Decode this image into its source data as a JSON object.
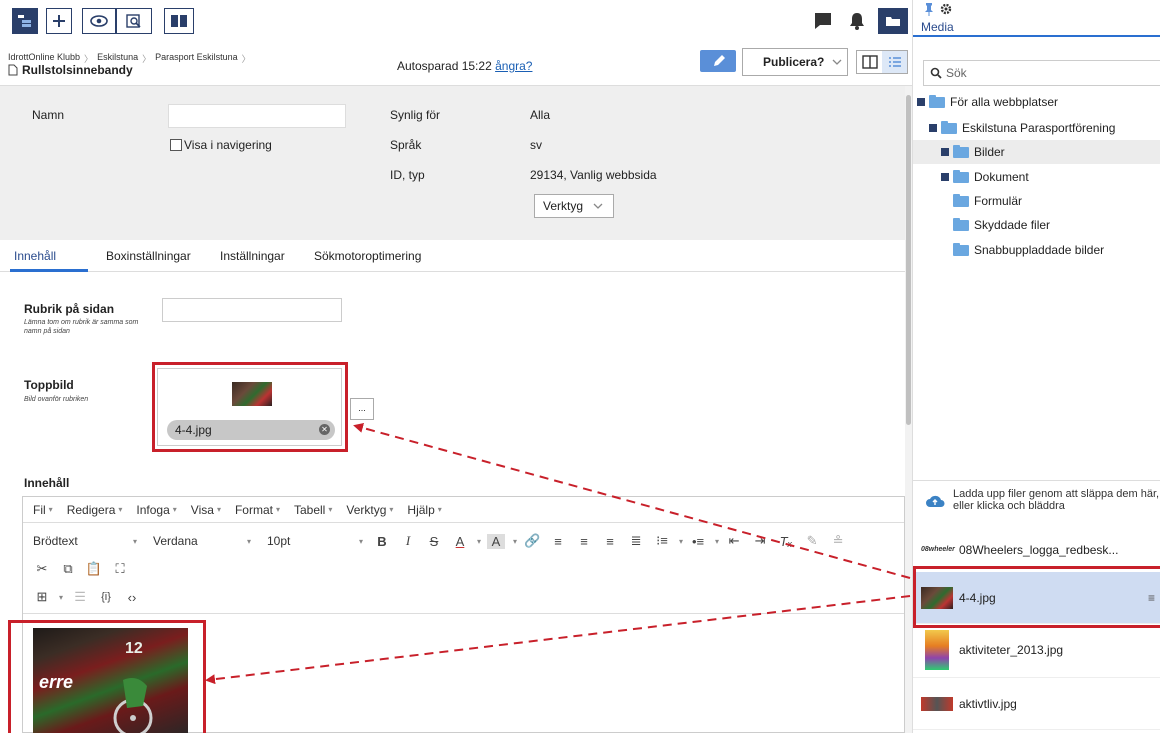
{
  "page_title": "Rullstolsinnebandy",
  "breadcrumb": [
    "IdrottOnline Klubb",
    "Eskilstuna",
    "Parasport Eskilstuna"
  ],
  "autosave": {
    "text": "Autosparad 15:22",
    "undo": "ångra?"
  },
  "publish_label": "Publicera?",
  "properties": {
    "name_label": "Namn",
    "show_in_nav": "Visa i navigering",
    "visible_for_label": "Synlig för",
    "visible_for_value": "Alla",
    "language_label": "Språk",
    "language_value": "sv",
    "id_type_label": "ID, typ",
    "id_type_value": "29134, Vanlig webbsida",
    "tools_label": "Verktyg"
  },
  "tabs": [
    "Innehåll",
    "Boxinställningar",
    "Inställningar",
    "Sökmotoroptimering"
  ],
  "fields": {
    "heading_label": "Rubrik på sidan",
    "heading_hint": "Lämna tom om rubrik är samma som namn på sidan",
    "top_image_label": "Toppbild",
    "top_image_hint": "Bild ovanför rubriken",
    "top_image_file": "4-4.jpg",
    "content_label": "Innehåll",
    "browse_label": "..."
  },
  "editor": {
    "menus": [
      "Fil",
      "Redigera",
      "Infoga",
      "Visa",
      "Format",
      "Tabell",
      "Verktyg",
      "Hjälp"
    ],
    "block_format": "Brödtext",
    "font_family": "Verdana",
    "font_size": "10pt",
    "source_label": "{i}",
    "image_logo_text": "erre",
    "image_jersey_number": "12"
  },
  "media": {
    "tab_label": "Media",
    "search_placeholder": "Sök",
    "tree": [
      {
        "label": "För alla webbplatser",
        "level": 0,
        "toggle": true
      },
      {
        "label": "Eskilstuna Parasportförening",
        "level": 1,
        "toggle": true
      },
      {
        "label": "Bilder",
        "level": 2,
        "toggle": true,
        "selected": true
      },
      {
        "label": "Dokument",
        "level": 2,
        "toggle": true
      },
      {
        "label": "Formulär",
        "level": 2,
        "toggle": false
      },
      {
        "label": "Skyddade filer",
        "level": 2,
        "toggle": false
      },
      {
        "label": "Snabbuppladdade bilder",
        "level": 2,
        "toggle": false
      }
    ],
    "upload_text": "Ladda upp filer genom att släppa dem här, eller klicka och bläddra",
    "files": [
      {
        "name": "08Wheelers_logga_redbesk...",
        "thumb_text": "08wheeler"
      },
      {
        "name": "4-4.jpg",
        "selected": true
      },
      {
        "name": "aktiviteter_2013.jpg"
      },
      {
        "name": "aktivtliv.jpg"
      }
    ]
  },
  "colors": {
    "accent": "#2a6fd0",
    "toolbar_navy": "#2a3f6a",
    "highlight_red": "#c8202a",
    "folder_blue": "#6aa7e0",
    "selected_file": "#cfdcf2"
  }
}
